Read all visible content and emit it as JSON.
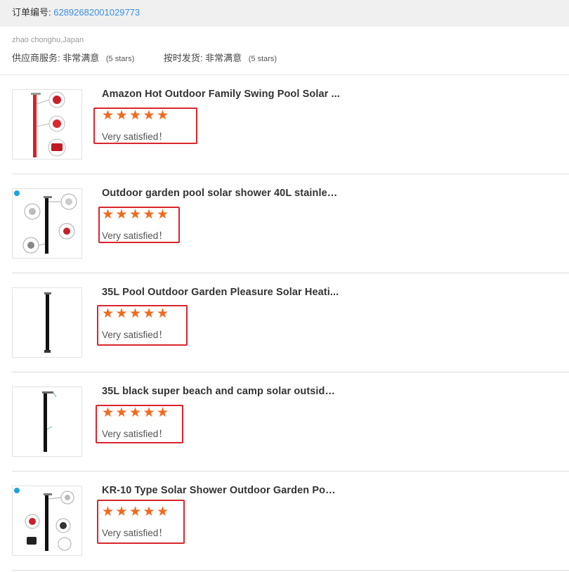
{
  "order": {
    "label": "订单编号: ",
    "number": "62892682001029773"
  },
  "buyer": {
    "name": "zhao chonghu,Japan",
    "supplier_service_label": "供应商服务:",
    "supplier_service_value": "非常满意",
    "supplier_service_stars": "(5 stars)",
    "ontime_label": "按时发货:",
    "ontime_value": "非常满意",
    "ontime_stars": "(5 stars)"
  },
  "star_glyph": "★",
  "items": [
    {
      "title": "Amazon Hot Outdoor Family Swing Pool Solar ...",
      "rating": 5,
      "review": "Very satisfied！",
      "image": "red-solar-shower-photo"
    },
    {
      "title": "Outdoor garden pool solar shower 40L stainles...",
      "rating": 5,
      "review": "Very satisfied！",
      "image": "black-solar-shower-photo"
    },
    {
      "title": "35L Pool Outdoor Garden Pleasure Solar Heati...",
      "rating": 5,
      "review": "Very satisfied！",
      "image": "black-solar-shower-photo"
    },
    {
      "title": "35L black super beach and camp solar outside ...",
      "rating": 5,
      "review": "Very satisfied！",
      "image": "black-solar-shower-photo"
    },
    {
      "title": "KR-10 Type Solar Shower Outdoor Garden Pool...",
      "rating": 5,
      "review": "Very satisfied！",
      "image": "black-solar-shower-photo"
    }
  ],
  "colors": {
    "star": "#f06a1e",
    "highlight": "#d9262c",
    "link": "#3a8ee6"
  }
}
